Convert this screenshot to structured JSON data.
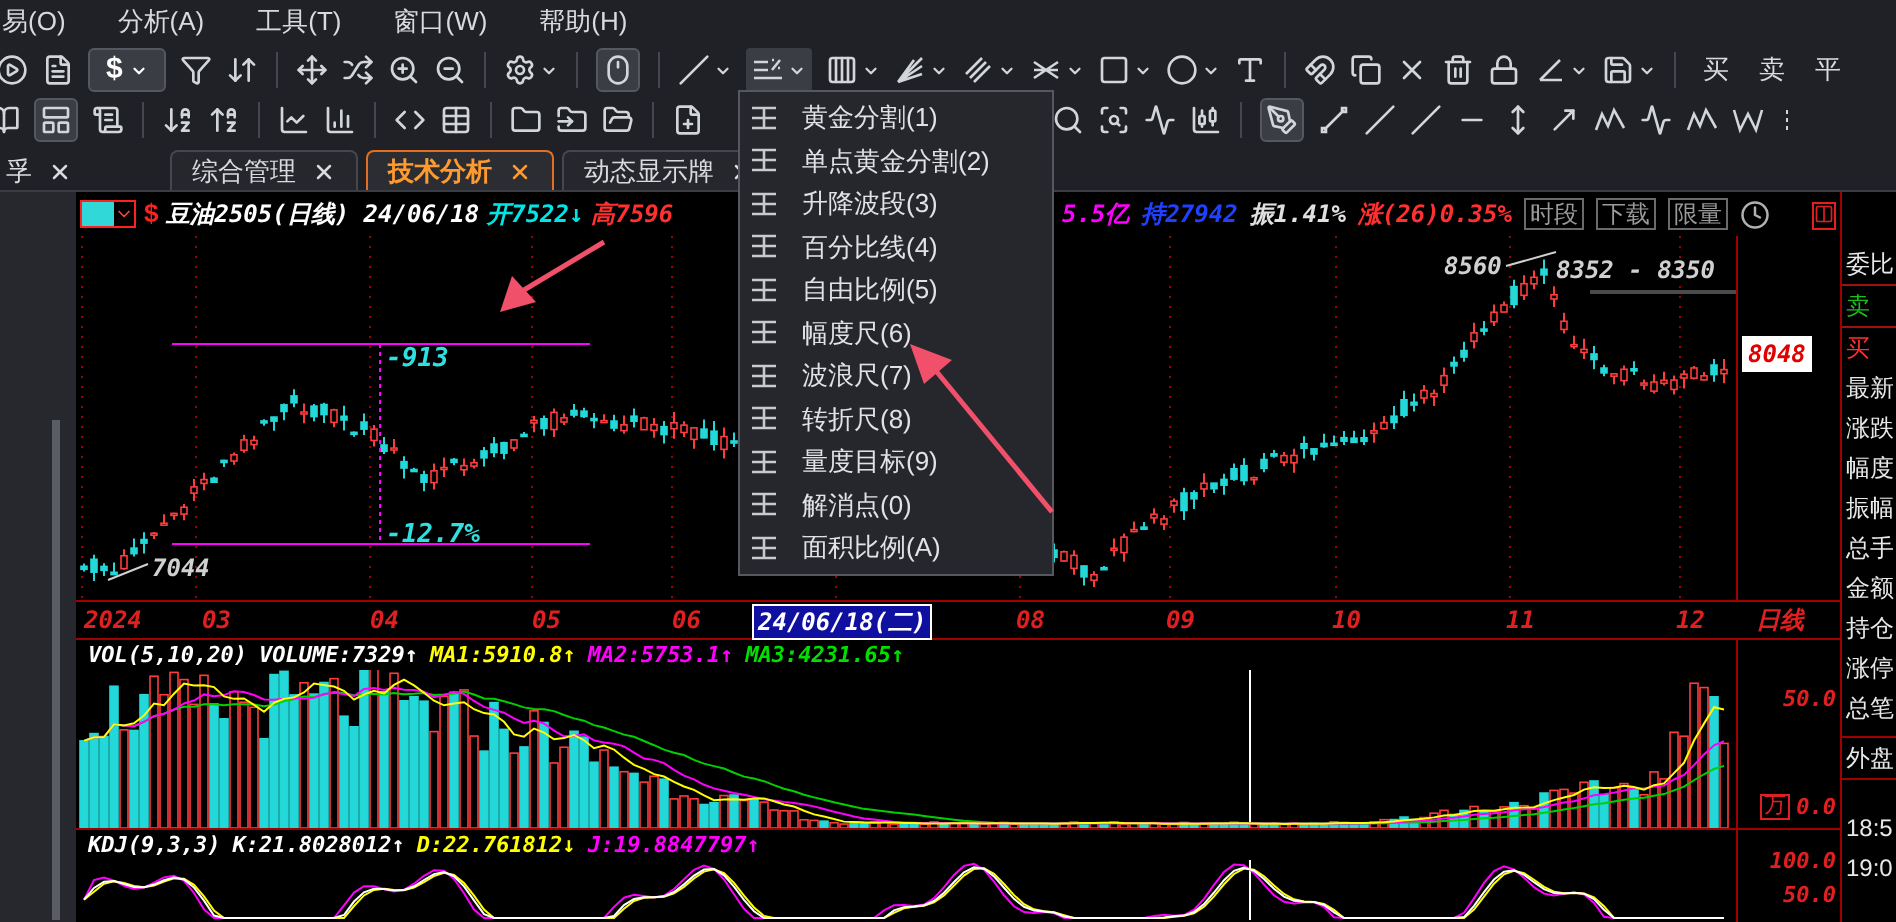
{
  "menu_bar": [
    "易(O)",
    "分析(A)",
    "工具(T)",
    "窗口(W)",
    "帮助(H)"
  ],
  "toolbar": {
    "currency_button": "$",
    "trade_buttons": [
      "买",
      "卖",
      "平"
    ]
  },
  "tabs": [
    {
      "label": "孚",
      "selected": false
    },
    {
      "label": "综合管理",
      "selected": false
    },
    {
      "label": "技术分析",
      "selected": true
    },
    {
      "label": "动态显示牌",
      "selected": false
    }
  ],
  "chart_header": {
    "symbol_mark": "$",
    "left_parts": [
      {
        "text": "豆油2505(日线) 24/06/18",
        "color": "#ffffff"
      },
      {
        "text": "开7522↓",
        "color": "#00e5e5"
      },
      {
        "text": "高7596",
        "color": "#ff3030"
      }
    ],
    "right_parts": [
      {
        "text": "5.5亿",
        "color": "#ff00ff"
      },
      {
        "text": "持27942",
        "color": "#2040ff"
      },
      {
        "text": "振1.41%",
        "color": "#e0e0e0"
      },
      {
        "text": "涨(26)0.35%",
        "color": "#ff3030"
      }
    ],
    "buttons": [
      "时段",
      "下载",
      "限量"
    ]
  },
  "price_chart": {
    "range_change": "-913",
    "range_percent": "-12.7%",
    "low_label": "7044",
    "high_label": "8560",
    "price_range": "8352 - 8350",
    "last_price": "8048"
  },
  "date_axis": [
    {
      "label": "2024",
      "highlighted": false
    },
    {
      "label": "03",
      "highlighted": false
    },
    {
      "label": "04",
      "highlighted": false
    },
    {
      "label": "05",
      "highlighted": false
    },
    {
      "label": "06",
      "highlighted": false
    },
    {
      "label": "24/06/18(二)",
      "highlighted": true
    },
    {
      "label": "08",
      "highlighted": false
    },
    {
      "label": "09",
      "highlighted": false
    },
    {
      "label": "10",
      "highlighted": false
    },
    {
      "label": "11",
      "highlighted": false
    },
    {
      "label": "12",
      "highlighted": false
    },
    {
      "label": "日线",
      "highlighted": false
    }
  ],
  "volume_panel": {
    "legend": [
      {
        "text": "VOL(5,10,20)",
        "color": "#ffffff"
      },
      {
        "text": "VOLUME:7329↑",
        "color": "#ffffff"
      },
      {
        "text": "MA1:5910.8↑",
        "color": "#ffff00"
      },
      {
        "text": "MA2:5753.1↑",
        "color": "#ff00ff"
      },
      {
        "text": "MA3:4231.65↑",
        "color": "#00e000"
      }
    ],
    "axis": [
      "50.0",
      "0.0"
    ],
    "unit": "万"
  },
  "kdj_panel": {
    "legend": [
      {
        "text": "KDJ(9,3,3)",
        "color": "#ffffff"
      },
      {
        "text": "K:21.8028012↑",
        "color": "#ffffff"
      },
      {
        "text": "D:22.761812↓",
        "color": "#ffff00"
      },
      {
        "text": "J:19.8847797↑",
        "color": "#ff00ff"
      }
    ],
    "axis": [
      "100.0",
      "50.0"
    ]
  },
  "quote_panel": [
    {
      "label": "委比",
      "kind": "label"
    },
    {
      "label": "卖",
      "kind": "sell"
    },
    {
      "label": "买",
      "kind": "buy"
    },
    {
      "label": "最新",
      "kind": "label"
    },
    {
      "label": "涨跌",
      "kind": "label"
    },
    {
      "label": "幅度",
      "kind": "label"
    },
    {
      "label": "振幅",
      "kind": "label"
    },
    {
      "label": "总手",
      "kind": "label"
    },
    {
      "label": "金额",
      "kind": "label"
    },
    {
      "label": "持仓",
      "kind": "label"
    },
    {
      "label": "涨停",
      "kind": "label"
    },
    {
      "label": "总笔",
      "kind": "label"
    },
    {
      "label": "外盘",
      "kind": "label"
    },
    {
      "label": "18:5",
      "kind": "time"
    },
    {
      "label": "19:0",
      "kind": "time"
    }
  ],
  "tool_menu": [
    "黄金分割(1)",
    "单点黄金分割(2)",
    "升降波段(3)",
    "百分比线(4)",
    "自由比例(5)",
    "幅度尺(6)",
    "波浪尺(7)",
    "转折尺(8)",
    "量度目标(9)",
    "解消点(0)",
    "面积比例(A)"
  ]
}
